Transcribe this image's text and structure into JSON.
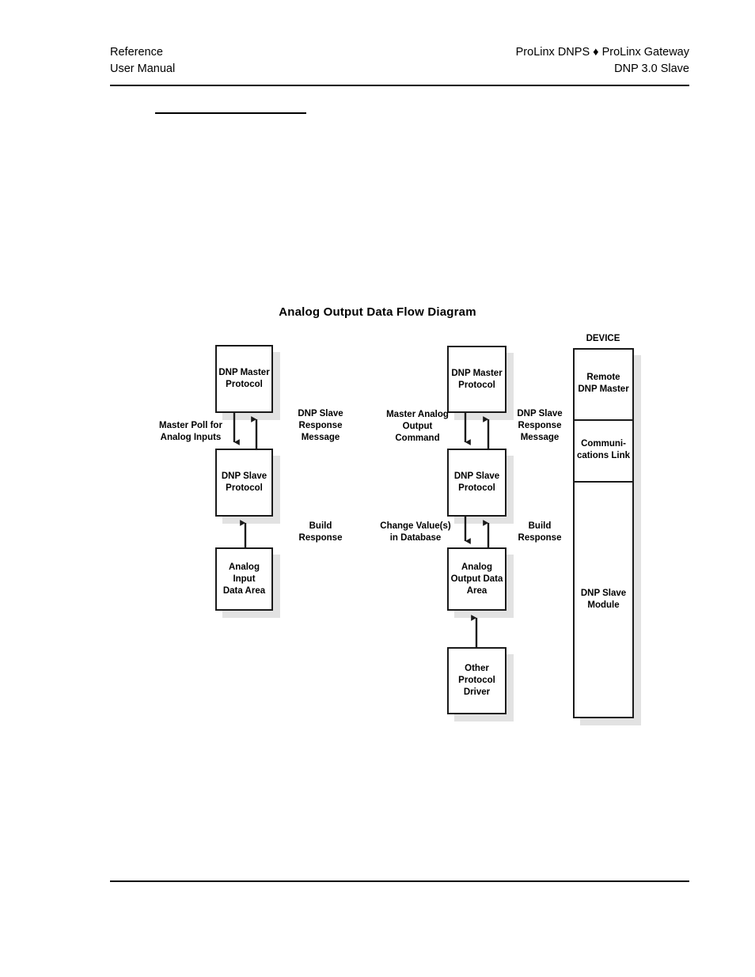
{
  "header": {
    "left_line1": "Reference",
    "left_line2": "User Manual",
    "right_line1": "ProLinx DNPS ♦ ProLinx Gateway",
    "right_line2": "DNP 3.0 Slave"
  },
  "diagram": {
    "title": "Analog Output Data Flow Diagram",
    "device_title": "DEVICE",
    "left_column": {
      "master_box": "DNP Master\nProtocol",
      "slave_box": "DNP Slave\nProtocol",
      "data_box": "Analog Input\nData Area",
      "left_label": "Master Poll for\nAnalog Inputs",
      "right_label_top": "DNP Slave\nResponse\nMessage",
      "right_label_bottom": "Build\nResponse"
    },
    "center_column": {
      "master_box": "DNP Master\nProtocol",
      "slave_box": "DNP Slave\nProtocol",
      "data_box": "Analog\nOutput Data\nArea",
      "other_box": "Other\nProtocol\nDriver",
      "left_label_top": "Master Analog\nOutput\nCommand",
      "left_label_bottom": "Change Value(s)\nin Database",
      "right_label_top": "DNP Slave\nResponse\nMessage",
      "right_label_bottom": "Build\nResponse"
    },
    "device_column": {
      "cell1": "Remote\nDNP Master",
      "cell2": "Communi-\ncations Link",
      "cell3": "DNP Slave\nModule"
    },
    "colors": {
      "stroke": "#1a1a1a",
      "shadow": "#e2e2e2",
      "background": "#ffffff"
    }
  }
}
